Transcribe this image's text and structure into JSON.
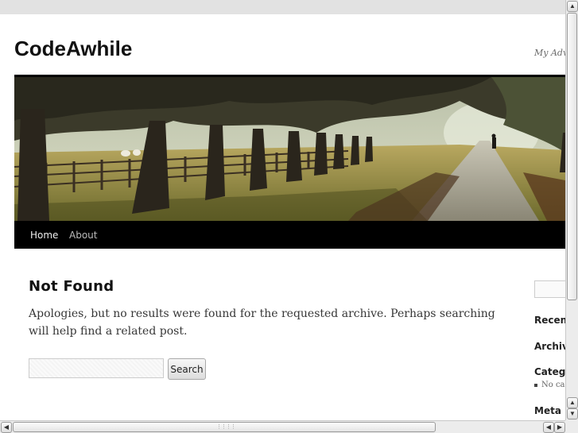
{
  "site": {
    "title": "CodeAwhile",
    "description": "My Adve"
  },
  "nav": {
    "items": [
      {
        "label": "Home"
      },
      {
        "label": "About"
      }
    ]
  },
  "main": {
    "title": "Not Found",
    "text": "Apologies, but no results were found for the requested archive. Perhaps searching will help find a related post.",
    "search_button": "Search",
    "search_value": ""
  },
  "sidebar": {
    "search_value": "",
    "headings": [
      "Recent",
      "Archiv",
      "Categ",
      "Meta"
    ],
    "category_item": "No ca"
  },
  "scrollbars": {
    "up_arrow": "▲",
    "down_arrow": "▼",
    "left_arrow": "◀",
    "right_arrow": "▶"
  },
  "colors": {
    "nav_background": "#000000",
    "page_background": "#ffffff",
    "outer_background": "#e2e2e2"
  }
}
